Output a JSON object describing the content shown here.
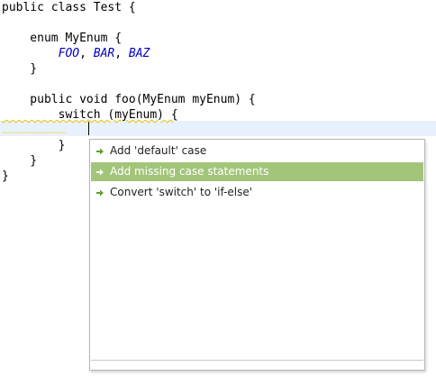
{
  "editor": {
    "lines": [
      {
        "text": "public class Test {"
      },
      {
        "text": ""
      },
      {
        "text": "    enum MyEnum {"
      },
      {
        "text": "        FOO, BAR, BAZ",
        "constants": [
          "FOO",
          "BAR",
          "BAZ"
        ]
      },
      {
        "text": "    }"
      },
      {
        "text": ""
      },
      {
        "text": "    public void foo(MyEnum myEnum) {"
      },
      {
        "text": "        switch (myEnum) {"
      },
      {
        "text": ""
      },
      {
        "text": "        }"
      },
      {
        "text": "    }"
      },
      {
        "text": "}"
      }
    ],
    "colors": {
      "enum_constant": "#0000c0",
      "current_line": "#e8f2fe",
      "warning_squiggle": "#f0c000"
    }
  },
  "quick_assist": {
    "items": [
      {
        "label": "Add 'default' case",
        "icon": "correction-arrow-icon",
        "selected": false
      },
      {
        "label": "Add missing case statements",
        "icon": "correction-arrow-icon",
        "selected": true
      },
      {
        "label": "Convert 'switch' to 'if-else'",
        "icon": "correction-arrow-icon",
        "selected": false
      }
    ],
    "colors": {
      "selection": "#a3c57a",
      "icon": "#5f9f35"
    }
  }
}
